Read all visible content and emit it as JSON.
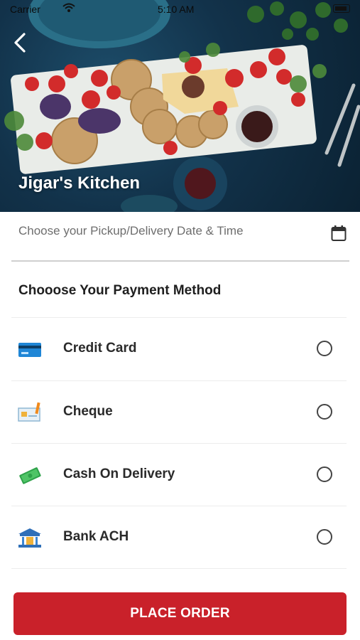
{
  "status_bar": {
    "carrier": "Carrier",
    "time": "5:10 AM"
  },
  "hero": {
    "title": "Jigar's Kitchen"
  },
  "datetime": {
    "placeholder": "Choose your Pickup/Delivery Date & Time"
  },
  "payment": {
    "title": "Chooose Your Payment Method",
    "methods": [
      {
        "label": "Credit Card",
        "icon": "credit-card-icon",
        "selected": false
      },
      {
        "label": "Cheque",
        "icon": "cheque-icon",
        "selected": false
      },
      {
        "label": "Cash On Delivery",
        "icon": "cash-icon",
        "selected": false
      },
      {
        "label": "Bank ACH",
        "icon": "bank-icon",
        "selected": false
      }
    ]
  },
  "actions": {
    "place_order": "PLACE ORDER"
  },
  "colors": {
    "accent": "#c9212a",
    "hero_bg": "#12324a"
  }
}
